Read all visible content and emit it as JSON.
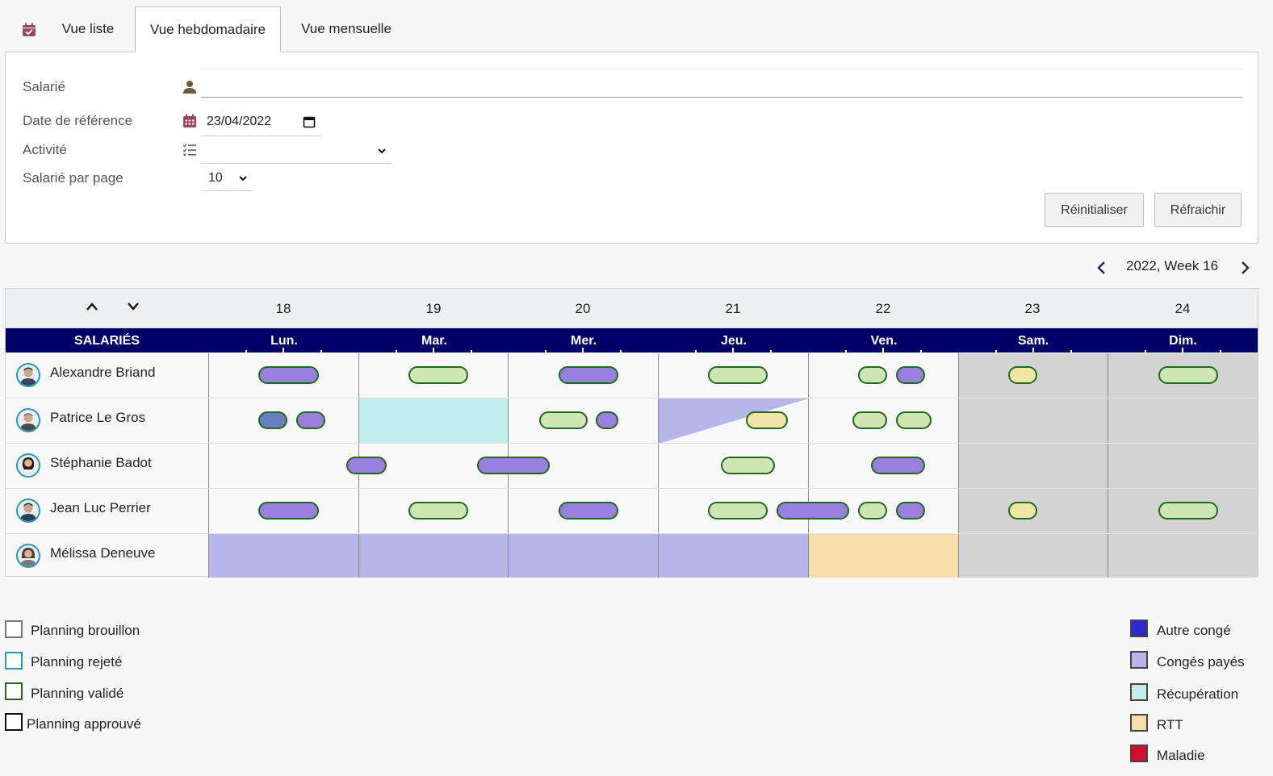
{
  "tabs": {
    "list": "Vue liste",
    "weekly": "Vue hebdomadaire",
    "monthly": "Vue mensuelle",
    "active": "weekly"
  },
  "form": {
    "salarie_label": "Salarié",
    "salarie_value": "",
    "date_label": "Date de référence",
    "date_value": "23/04/2022",
    "activite_label": "Activité",
    "activite_value": "",
    "perpage_label": "Salarié par page",
    "perpage_value": "10",
    "reset_button": "Réinitialiser",
    "refresh_button": "Réfraichir"
  },
  "week": {
    "label": "2022, Week 16"
  },
  "grid": {
    "header_label": "SALARIÉS",
    "days": [
      {
        "num": "18",
        "name": "Lun."
      },
      {
        "num": "19",
        "name": "Mar."
      },
      {
        "num": "20",
        "name": "Mer."
      },
      {
        "num": "21",
        "name": "Jeu."
      },
      {
        "num": "22",
        "name": "Ven."
      },
      {
        "num": "23",
        "name": "Sam."
      },
      {
        "num": "24",
        "name": "Dim."
      }
    ],
    "employees": [
      {
        "name": "Alexandre Briand"
      },
      {
        "name": "Patrice Le Gros"
      },
      {
        "name": "Stéphanie Badot"
      },
      {
        "name": "Jean Luc Perrier"
      },
      {
        "name": "Mélissa Deneuve"
      }
    ]
  },
  "legend": {
    "status": [
      {
        "label": "Planning brouillon",
        "color": "#777777"
      },
      {
        "label": "Planning rejeté",
        "color": "#2a9ab0"
      },
      {
        "label": "Planning validé",
        "color": "#1f6a1f"
      },
      {
        "label": "Planning approuvé",
        "color": "#111111"
      }
    ],
    "absence": [
      {
        "label": "Autre congé",
        "color": "#2a2ad0"
      },
      {
        "label": "Congés payés",
        "color": "#b8b5ea"
      },
      {
        "label": "Récupération",
        "color": "#c4eeee"
      },
      {
        "label": "RTT",
        "color": "#f8dcaa"
      },
      {
        "label": "Maladie",
        "color": "#d01030"
      }
    ]
  },
  "colors": {
    "header_bar": "#000066",
    "conges_payes": "#b8b5ea",
    "recuperation": "#c4eeee",
    "rtt": "#f8dcaa",
    "weekend": "#d3d3d3"
  }
}
